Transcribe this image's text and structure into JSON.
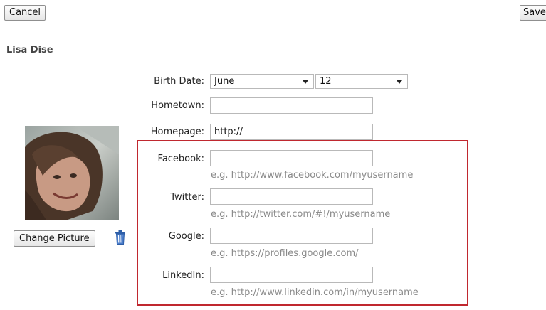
{
  "toolbar": {
    "cancel_label": "Cancel",
    "save_label": "Save"
  },
  "profile": {
    "name": "Lisa Dise",
    "change_picture_label": "Change Picture"
  },
  "form": {
    "birth_date": {
      "label": "Birth Date:",
      "month": "June",
      "day": "12"
    },
    "hometown": {
      "label": "Hometown:",
      "value": ""
    },
    "homepage": {
      "label": "Homepage:",
      "value": "http://"
    },
    "facebook": {
      "label": "Facebook:",
      "value": "",
      "hint": "e.g. http://www.facebook.com/myusername"
    },
    "twitter": {
      "label": "Twitter:",
      "value": "",
      "hint": "e.g. http://twitter.com/#!/myusername"
    },
    "google": {
      "label": "Google:",
      "value": "",
      "hint": "e.g. https://profiles.google.com/"
    },
    "linkedin": {
      "label": "LinkedIn:",
      "value": "",
      "hint": "e.g. http://www.linkedin.com/in/myusername"
    }
  },
  "icons": {
    "delete": "trash-icon",
    "dropdown": "chevron-down-icon"
  },
  "colors": {
    "highlight_border": "#c0282f",
    "hint_text": "#8a8a8a"
  }
}
